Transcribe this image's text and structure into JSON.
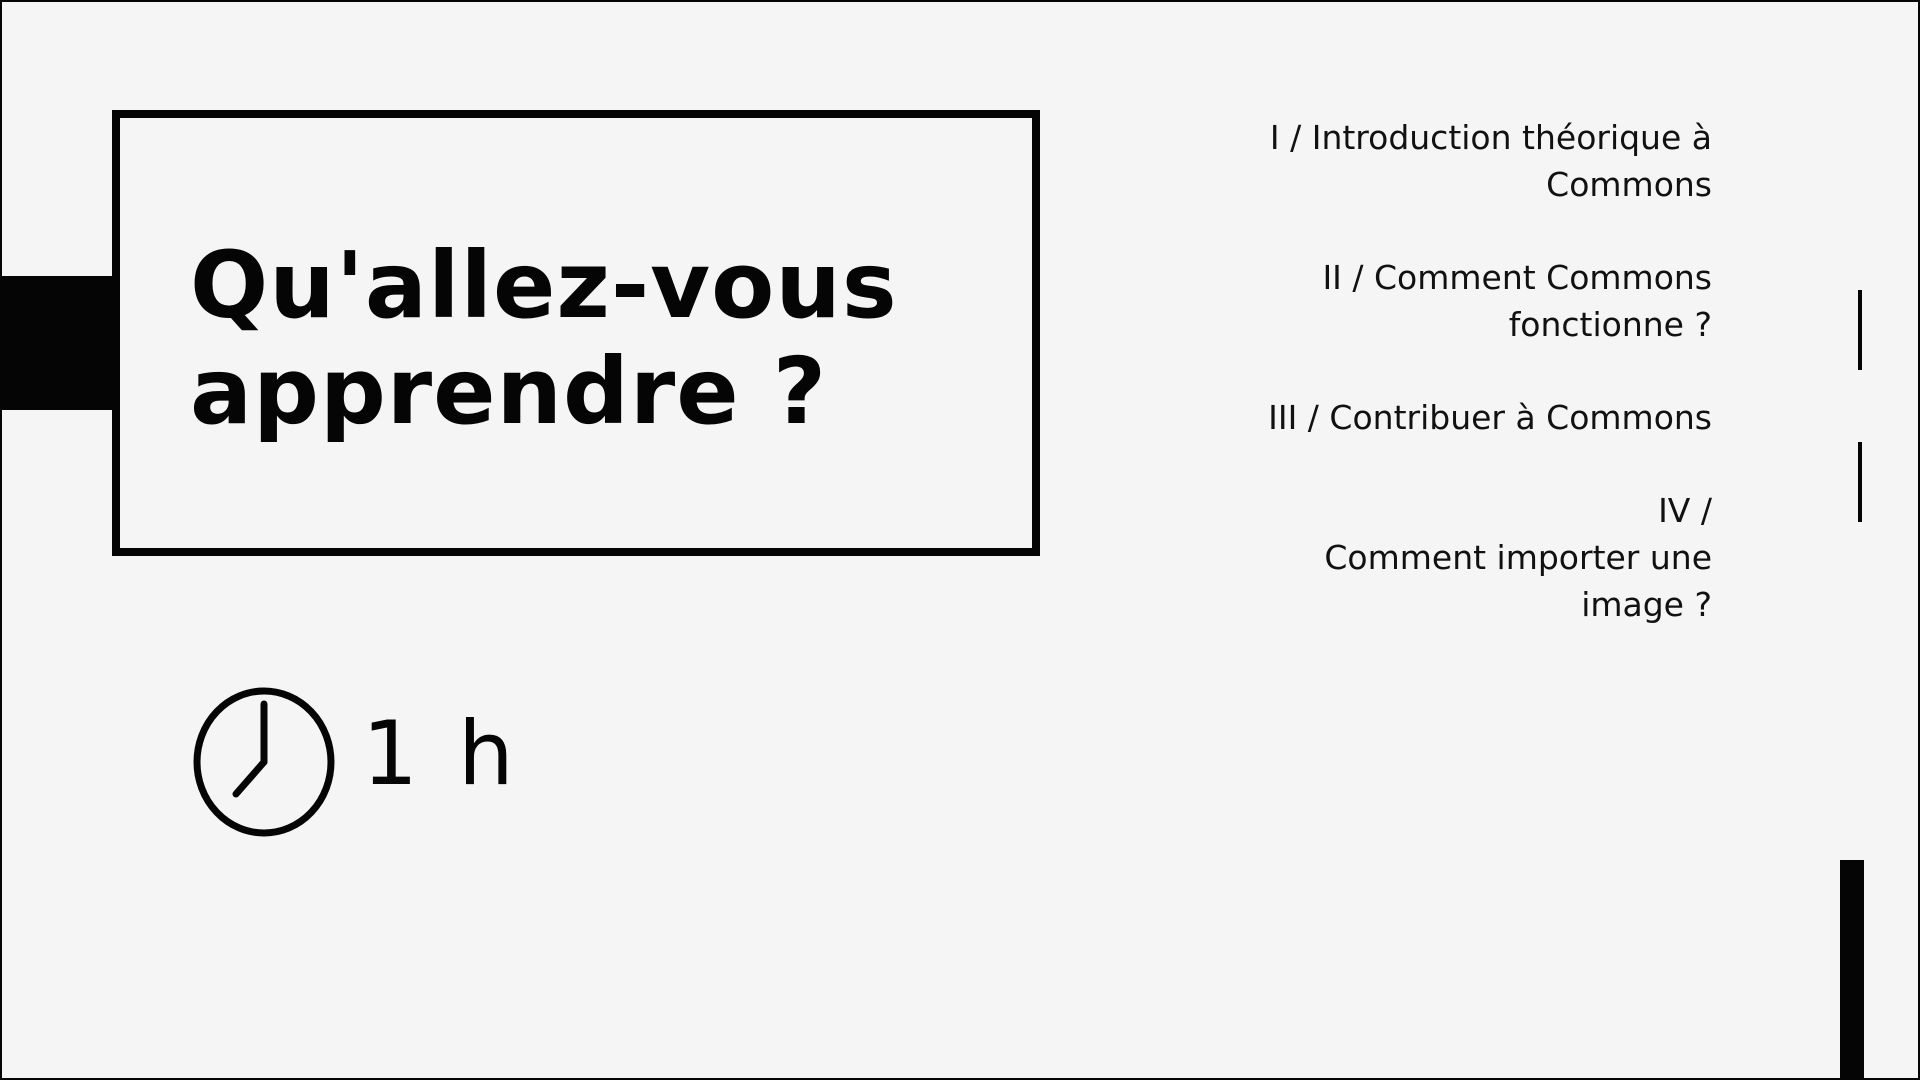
{
  "title": {
    "line1": "Qu'allez-vous",
    "line2": "apprendre ?"
  },
  "duration": {
    "icon": "clock-icon",
    "label": "1 h"
  },
  "agenda": {
    "items": [
      "I / Introduction théorique à\nCommons",
      "II / Comment Commons\nfonctionne ?",
      "III / Contribuer à Commons",
      "IV / \nComment importer une\nimage ?"
    ]
  },
  "colors": {
    "background": "#f5f5f5",
    "ink": "#050505"
  }
}
